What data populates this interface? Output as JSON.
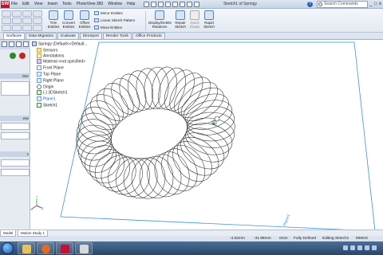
{
  "app": {
    "logo": "SW",
    "menus": [
      "File",
      "Edit",
      "View",
      "Insert",
      "Tools",
      "PhotoView 360",
      "Window",
      "Help"
    ],
    "doc_title": "Sketch1 of Springy",
    "search_placeholder": "Search Commands"
  },
  "ribbon": {
    "trim": "Trim Entities",
    "convert": "Convert Entities",
    "offset": "Offset Entities",
    "mirror": "Mirror Entities",
    "linear": "Linear Sketch Pattern",
    "move": "Move Entities",
    "display": "Display/Delete Relations",
    "repair": "Repair Sketch",
    "quick": "Quick Snaps",
    "rapid": "Rapid Sketch"
  },
  "tabs": [
    "Surfaces",
    "Data Migration",
    "Evaluate",
    "DimXpert",
    "Render Tools",
    "Office Products"
  ],
  "tree": [
    {
      "label": "Springy  (Default<<Default...",
      "kind": "root"
    },
    {
      "label": "Sensors",
      "kind": "sens"
    },
    {
      "label": "Annotations",
      "kind": "ann"
    },
    {
      "label": "Material <not specified>",
      "kind": "mat"
    },
    {
      "label": "Front Plane",
      "kind": "plane"
    },
    {
      "label": "Top Plane",
      "kind": "plane"
    },
    {
      "label": "Right Plane",
      "kind": "plane"
    },
    {
      "label": "Origin",
      "kind": "orig"
    },
    {
      "label": "(-) 3DSketch1",
      "kind": "sk"
    },
    {
      "label": "Plane1",
      "kind": "plane",
      "highlight": true
    },
    {
      "label": "Sketch1",
      "kind": "sk"
    }
  ],
  "left_panel": {
    "header_1": "ther",
    "header_2": "ese",
    "header_3": "s"
  },
  "view_tabs": [
    "Model",
    "Motion Study 1"
  ],
  "status": {
    "x": "-4.02mm",
    "y": "-31.98mm",
    "z": "0mm",
    "state": "Fully Defined",
    "editing": "Editing Sketch1",
    "units": "MMGS"
  },
  "canvas": {
    "plane_label": "Plane1",
    "spring_color": "#2a2a2a",
    "plane_color": "#3a93d6"
  }
}
